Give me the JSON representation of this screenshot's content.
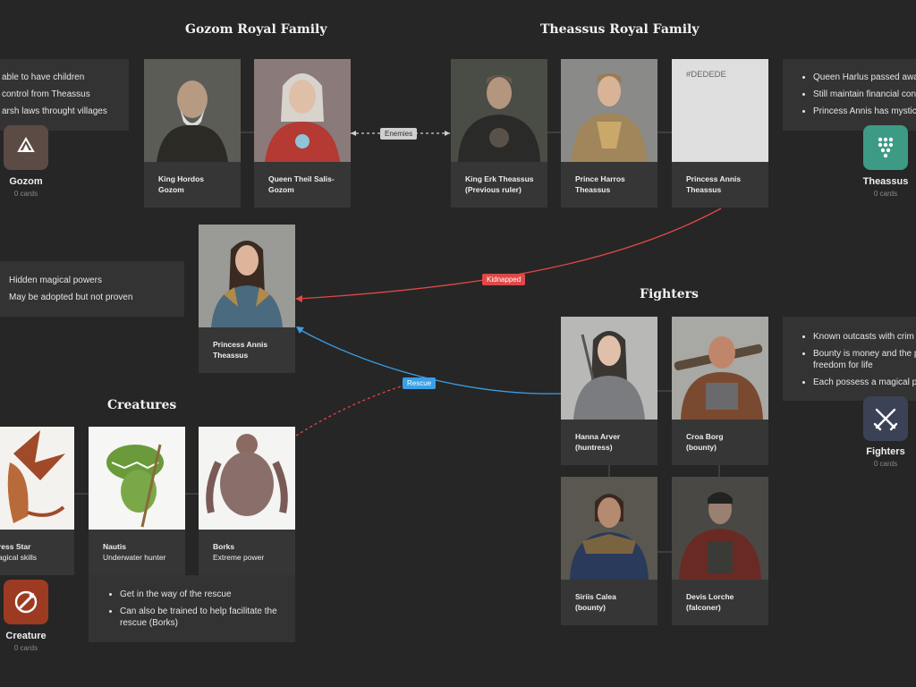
{
  "headings": {
    "gozom": "Gozom Royal Family",
    "theassus": "Theassus Royal Family",
    "fighters": "Fighters",
    "creatures": "Creatures"
  },
  "link_labels": {
    "enemies": "Enemies",
    "kidnapped": "Kidnapped",
    "rescue": "Rescue"
  },
  "cards": {
    "king_hordos": {
      "name": "King Hordos",
      "sub": "Gozom"
    },
    "queen_theil": {
      "name": "Queen Theil Salis-",
      "sub": "Gozom"
    },
    "king_erk": {
      "name": "King Erk Theassus",
      "sub": "(Previous ruler)"
    },
    "prince_harros": {
      "name": "Prince Harros",
      "sub": "Theassus"
    },
    "princess_annis_top": {
      "name": "Princess Annis",
      "sub": "Theassus",
      "placeholder": "#DEDEDE"
    },
    "princess_annis": {
      "name": "Princess Annis",
      "sub": "Theassus"
    },
    "hanna": {
      "name": "Hanna Arver",
      "sub": "(huntress)"
    },
    "croa": {
      "name": "Croa Borg",
      "sub": "(bounty)"
    },
    "siriis": {
      "name": "Siriis Calea",
      "sub": "(bounty)"
    },
    "devis": {
      "name": "Devis Lorche",
      "sub": "(falconer)"
    },
    "ress_star": {
      "name": "ress Star",
      "sub": "agical skills"
    },
    "nautis": {
      "name": "Nautis",
      "sub": "Underwater hunter"
    },
    "borks": {
      "name": "Borks",
      "sub": "Extreme power"
    }
  },
  "notes": {
    "gozom": [
      "able to have children",
      "control from Theassus",
      "arsh laws throught villages"
    ],
    "theassus": [
      "Queen Harlus passed awa",
      "Still maintain financial con",
      "Princess Annis has mystic"
    ],
    "annis": [
      "Hidden magical powers",
      "May be adopted but not proven"
    ],
    "fighters": [
      "Known outcasts with crim",
      "Bounty is money and the p freedom for life",
      "Each possess a magical p"
    ],
    "creatures": [
      "Get in the way of the rescue",
      "Can also be trained to help facilitate the rescue (Borks)"
    ]
  },
  "boards": {
    "gozom": {
      "name": "Gozom",
      "count": "0 cards",
      "color": "#5c4a45",
      "icon": "triangle-icon"
    },
    "theassus": {
      "name": "Theassus",
      "count": "0 cards",
      "color": "#3c9a85",
      "icon": "dots-icon"
    },
    "fighters": {
      "name": "Fighters",
      "count": "0 cards",
      "color": "#3b4256",
      "icon": "crossed-swords-icon"
    },
    "creature": {
      "name": "Creature",
      "count": "0 cards",
      "color": "#9c3b22",
      "icon": "creature-icon"
    }
  },
  "colors": {
    "background": "#262626",
    "kidnapped": "#e04848",
    "rescue": "#3aa0e6",
    "enemies": "#cfcfcf"
  }
}
